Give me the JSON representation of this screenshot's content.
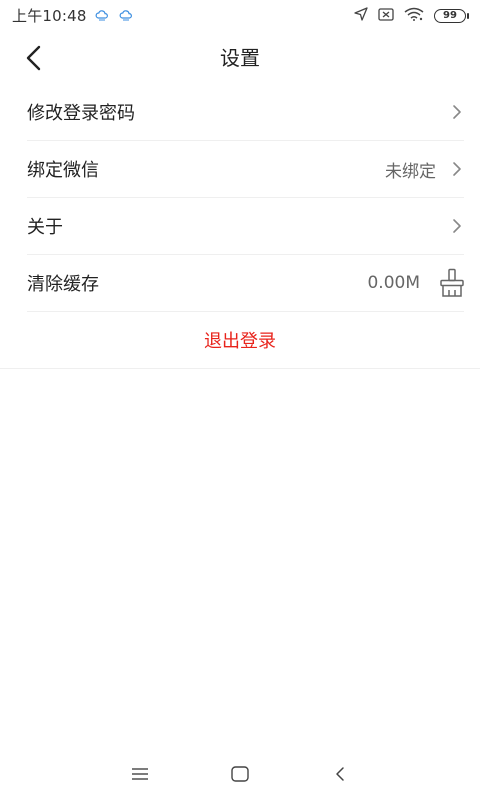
{
  "status_bar": {
    "time": "上午10:48",
    "battery": "99"
  },
  "header": {
    "title": "设置"
  },
  "settings": {
    "items": [
      {
        "label": "修改登录密码",
        "value": ""
      },
      {
        "label": "绑定微信",
        "value": "未绑定"
      },
      {
        "label": "关于",
        "value": ""
      },
      {
        "label": "清除缓存",
        "value": "0.00M"
      }
    ],
    "logout_label": "退出登录"
  },
  "icons": {
    "back": "chevron-left-icon",
    "chevron": "chevron-right-icon",
    "clear_cache": "broom-icon",
    "nav_menu": "menu-icon",
    "nav_home": "home-icon",
    "nav_back": "back-icon"
  },
  "colors": {
    "logout": "#e8231b",
    "divider": "#efefef",
    "text": "#222222",
    "secondary_text": "#666666"
  }
}
